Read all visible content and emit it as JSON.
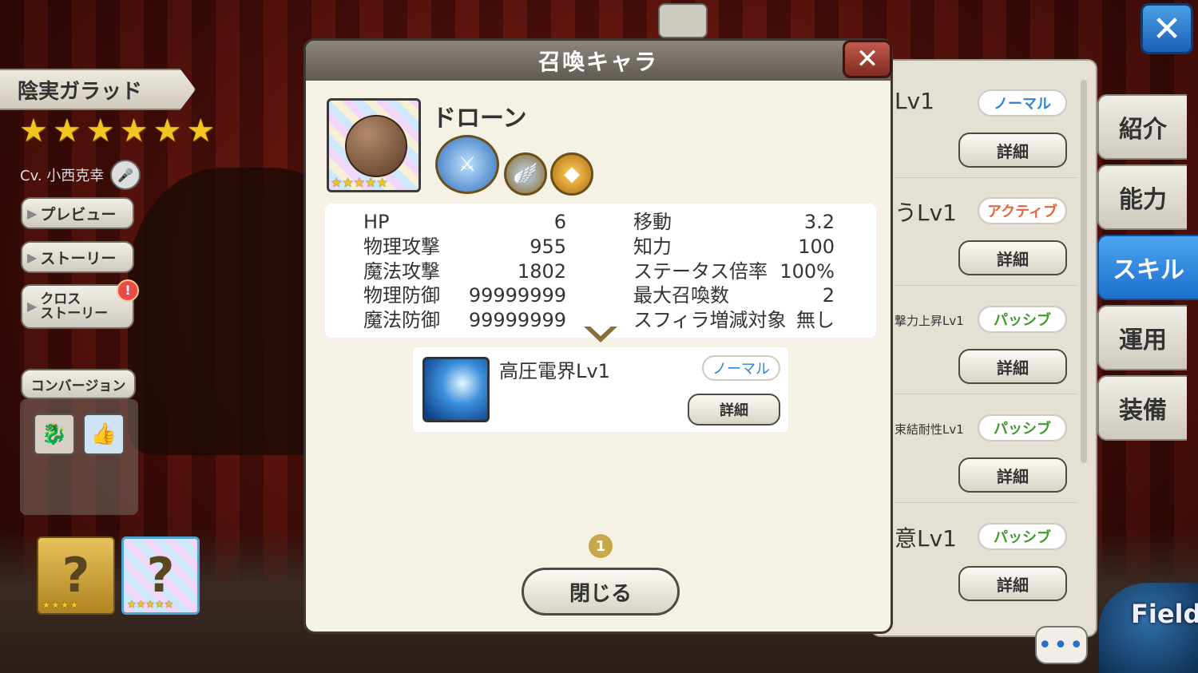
{
  "character": {
    "name": "陰実ガラッド",
    "stars": [
      "★",
      "★",
      "★",
      "★",
      "★",
      "★"
    ],
    "cv": "Cv. 小西克幸"
  },
  "side_buttons": {
    "preview": "プレビュー",
    "story": "ストーリー",
    "cross_story_line1": "クロス",
    "cross_story_line2": "ストーリー",
    "cross_badge": "!",
    "conversion": "コンバージョン"
  },
  "summon_slots": [
    {
      "label": "?",
      "stars": "★★★★"
    },
    {
      "label": "?",
      "stars": "★★★★★"
    }
  ],
  "modal": {
    "title": "召喚キャラ",
    "summon_name": "ドローン",
    "portrait_stars": "★★★★★",
    "stats_left": [
      {
        "label": "HP",
        "value": "6"
      },
      {
        "label": "物理攻撃",
        "value": "955"
      },
      {
        "label": "魔法攻撃",
        "value": "1802"
      },
      {
        "label": "物理防御",
        "value": "99999999"
      },
      {
        "label": "魔法防御",
        "value": "99999999"
      }
    ],
    "stats_right": [
      {
        "label": "移動",
        "value": "3.2"
      },
      {
        "label": "知力",
        "value": "100"
      },
      {
        "label": "ステータス倍率",
        "value": "100%"
      },
      {
        "label": "最大召喚数",
        "value": "2"
      },
      {
        "label": "スフィラ増減対象",
        "value": "無し"
      }
    ],
    "skill": {
      "name": "高圧電界Lv1",
      "type": "ノーマル",
      "detail": "詳細"
    },
    "page": "1",
    "close_label": "閉じる"
  },
  "skills_list": [
    {
      "name": "Lv1",
      "type": "ノーマル",
      "type_class": "normal",
      "detail": "詳細"
    },
    {
      "name": "うLv1",
      "type": "アクティブ",
      "type_class": "active",
      "detail": "詳細"
    },
    {
      "name": "撃力上昇Lv1",
      "type": "パッシブ",
      "type_class": "passive",
      "detail": "詳細"
    },
    {
      "name": "束結耐性Lv1",
      "type": "パッシブ",
      "type_class": "passive",
      "detail": "詳細"
    },
    {
      "name": "意Lv1",
      "type": "パッシブ",
      "type_class": "passive",
      "detail": "詳細"
    }
  ],
  "tabs": [
    "紹介",
    "能力",
    "スキル",
    "運用",
    "装備"
  ],
  "active_tab": "スキル",
  "field_label": "Field",
  "chat_label": "•••",
  "colors": {
    "accent_blue": "#1d6fcc",
    "normal_tag": "#2a85d8",
    "active_tag": "#e2663a",
    "passive_tag": "#3f9a2a",
    "star_gold": "#f2c522"
  }
}
